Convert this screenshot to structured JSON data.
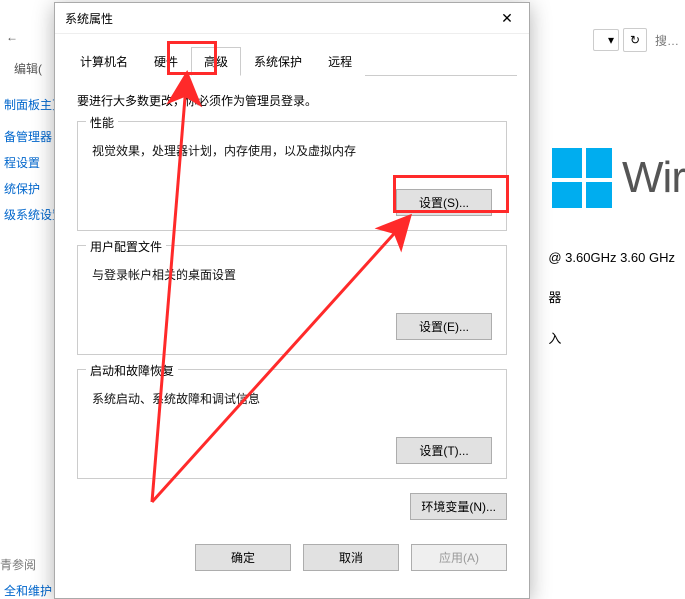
{
  "dialog": {
    "title": "系统属性",
    "tabs": [
      "计算机名",
      "硬件",
      "高级",
      "系统保护",
      "远程"
    ],
    "active_tab_index": 2,
    "intro": "要进行大多数更改，你必须作为管理员登录。",
    "group_perf": {
      "legend": "性能",
      "desc": "视觉效果，处理器计划，内存使用，以及虚拟内存",
      "button": "设置(S)..."
    },
    "group_profile": {
      "legend": "用户配置文件",
      "desc": "与登录帐户相关的桌面设置",
      "button": "设置(E)..."
    },
    "group_startup": {
      "legend": "启动和故障恢复",
      "desc": "系统启动、系统故障和调试信息",
      "button": "设置(T)..."
    },
    "env_button": "环境变量(N)...",
    "footer": {
      "ok": "确定",
      "cancel": "取消",
      "apply": "应用(A)"
    }
  },
  "bg": {
    "nav_back_glyph": "←",
    "edit_label": "编辑(",
    "links": {
      "cp_home": "制面板主页",
      "dev_mgr": "备管理器",
      "remote": "程设置",
      "protect": "统保护",
      "adv": "级系统设置",
      "see_also": "青参阅",
      "sec": "全和维护"
    },
    "dropdown_glyph": "▾",
    "refresh_glyph": "↻",
    "search_placeholder": "搜…",
    "win_text": "Wir",
    "cpu": "@ 3.60GHz   3.60 GHz",
    "label_ram": "器",
    "label_pen": "入"
  }
}
